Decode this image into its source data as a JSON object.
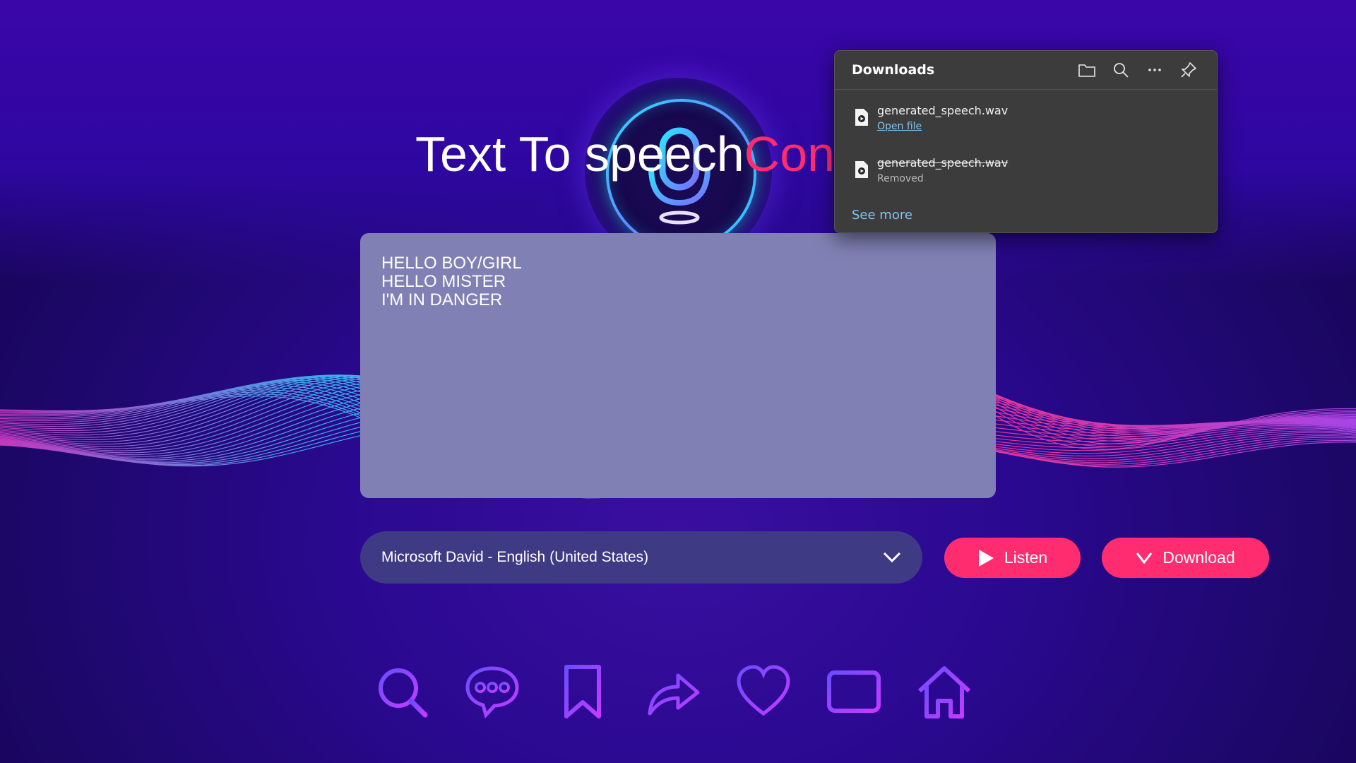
{
  "title": {
    "main": "Text To speech",
    "accent": "Conv"
  },
  "editor": {
    "lines": [
      "HELLO BOY/GIRL",
      "HELLO MISTER",
      "I'M IN DANGER"
    ]
  },
  "voice_select": {
    "selected": "Microsoft David - English (United States)"
  },
  "buttons": {
    "listen_label": "Listen",
    "download_label": "Download"
  },
  "bottom_nav": {
    "icons": [
      "search-icon",
      "chat-icon",
      "bookmark-icon",
      "share-icon",
      "heart-icon",
      "add-icon",
      "home-icon"
    ]
  },
  "downloads": {
    "title": "Downloads",
    "items": [
      {
        "name": "generated_speech.wav",
        "status": "Open file",
        "state": "available"
      },
      {
        "name": "generated_speech.wav",
        "status": "Removed",
        "state": "removed"
      }
    ],
    "see_more": "See more"
  },
  "colors": {
    "accent": "#ff2d6f",
    "background": "#2e07a0",
    "editor_bg": "#8080b4",
    "select_bg": "#3e3a84",
    "popup_bg": "#3c3c3c",
    "link": "#7fc6f2"
  }
}
